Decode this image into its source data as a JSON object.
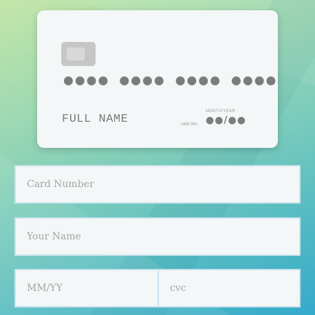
{
  "card": {
    "number_groups": [
      "●●●●",
      "●●●●",
      "●●●●",
      "●●●●"
    ],
    "name": "FULL NAME",
    "expiry_label": "MONTH/YEAR",
    "valid_thru": "valid thru",
    "expiry_value": "●●/●●"
  },
  "form": {
    "card_number_placeholder": "Card Number",
    "name_placeholder": "Your Name",
    "expiry_placeholder": "MM/YY",
    "cvc_placeholder": "cvc"
  }
}
